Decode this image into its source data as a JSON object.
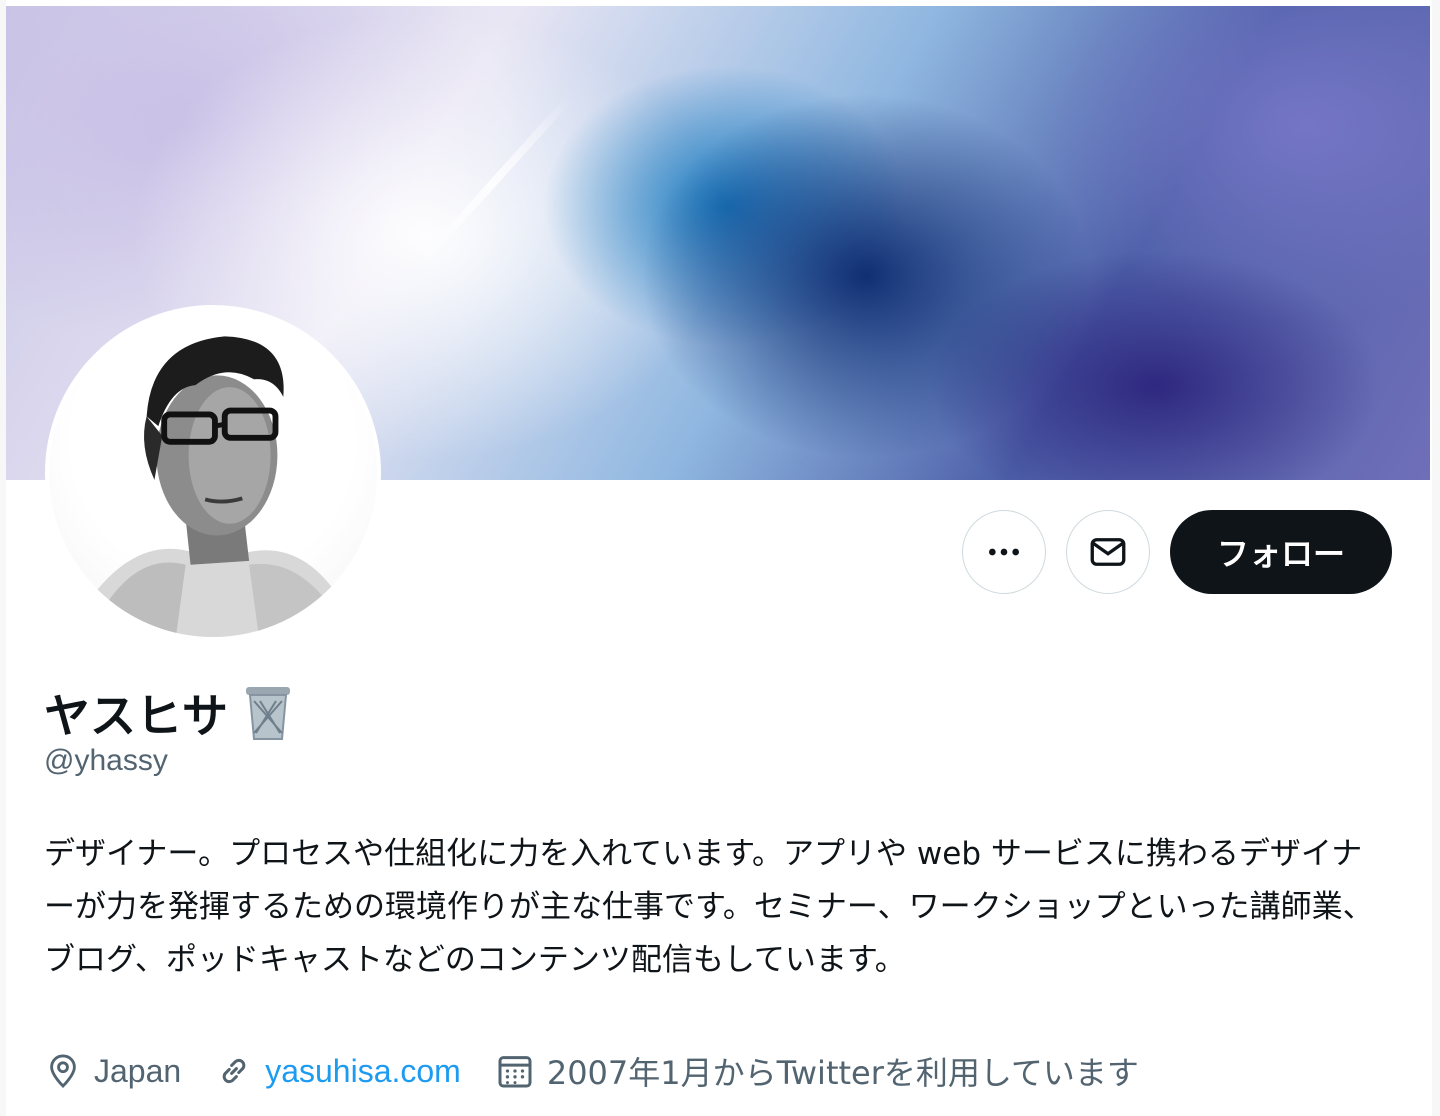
{
  "profile": {
    "display_name": "ヤスヒサ",
    "badge_icon": "wastebasket-emoji-icon",
    "handle": "@yhassy",
    "bio": "デザイナー。プロセスや仕組化に力を入れています。アプリや web サービスに携わるデザイナーが力を発揮するための環境作りが主な仕事です。セミナー、ワークショップといった講師業、ブログ、ポッドキャストなどのコンテンツ配信もしています。",
    "location": "Japan",
    "website": "yasuhisa.com",
    "joined": "2007年1月からTwitterを利用しています"
  },
  "actions": {
    "more_icon": "more-dots-icon",
    "message_icon": "envelope-icon",
    "follow_label": "フォロー"
  },
  "meta_icons": {
    "location": "location-pin-icon",
    "website": "link-icon",
    "joined": "calendar-icon"
  },
  "colors": {
    "text_primary": "#0f1419",
    "text_secondary": "#536471",
    "link": "#1d9bf0",
    "follow_bg": "#0f1419",
    "border": "#cfd9de"
  }
}
